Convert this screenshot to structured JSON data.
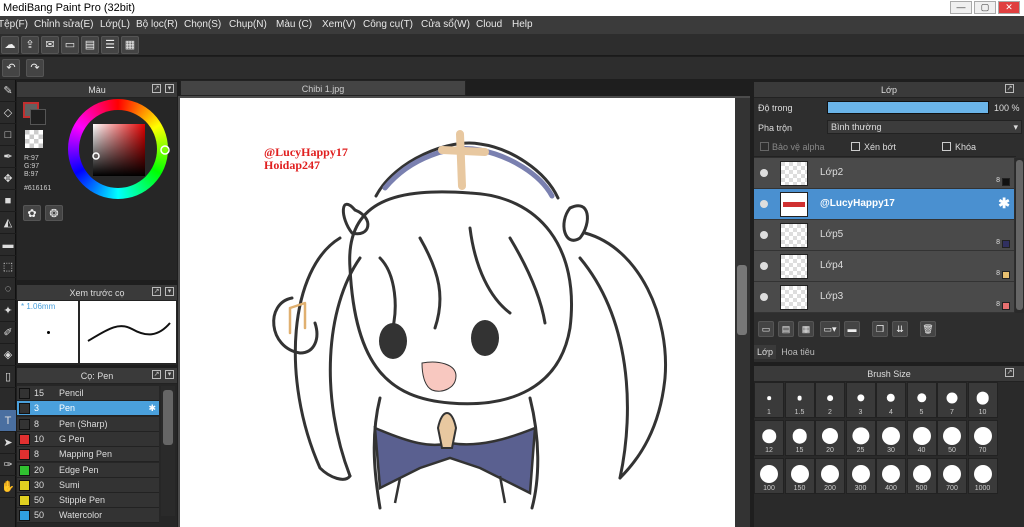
{
  "window": {
    "title": "MediBang Paint Pro (32bit)",
    "minimize": "—",
    "maximize": "▢",
    "close": "✕"
  },
  "menu": [
    "Tệp(F)",
    "Chỉnh sửa(E)",
    "Lớp(L)",
    "Bộ lọc(R)",
    "Chọn(S)",
    "Chụp(N)",
    "Màu (C)",
    "Xem(V)",
    "Công cụ(T)",
    "Cửa sổ(W)",
    "Cloud",
    "Help"
  ],
  "toolbar": {
    "cloud_icon": "cloud-icon",
    "share_icon": "share-icon",
    "comment_icon": "comment-icon",
    "undo_icon": "undo-icon",
    "redo_icon": "redo-icon"
  },
  "color_panel": {
    "title": "Màu",
    "rgb": "R:97\nG:97\nB:97",
    "hex": "#616161",
    "fg_color": "#616161"
  },
  "preview_panel": {
    "title": "Xem trước cọ",
    "size": "1.06mm"
  },
  "brush_panel": {
    "title": "Cọ: Pen",
    "items": [
      {
        "num": "15",
        "name": "Pencil",
        "color": "#333333"
      },
      {
        "num": "3",
        "name": "Pen",
        "color": "#333333",
        "selected": true
      },
      {
        "num": "8",
        "name": "Pen (Sharp)",
        "color": "#333333"
      },
      {
        "num": "10",
        "name": "G Pen",
        "color": "#e03030"
      },
      {
        "num": "8",
        "name": "Mapping Pen",
        "color": "#e03030"
      },
      {
        "num": "20",
        "name": "Edge Pen",
        "color": "#30c030"
      },
      {
        "num": "30",
        "name": "Sumi",
        "color": "#e0d020"
      },
      {
        "num": "50",
        "name": "Stipple Pen",
        "color": "#e0d020"
      },
      {
        "num": "50",
        "name": "Watercolor",
        "color": "#30a0e0"
      }
    ]
  },
  "document": {
    "tab": "Chibi 1.jpg",
    "watermark1": "@LucyHappy17",
    "watermark2": "Hoidap247"
  },
  "layer_panel": {
    "title": "Lớp",
    "opacity_label": "Độ trong",
    "opacity_value": "100 %",
    "opacity_fraction": 1.0,
    "blend_label": "Pha trộn",
    "blend_value": "Bình thường",
    "alpha_label": "Bảo vệ alpha",
    "clip_label": "Xén bớt",
    "lock_label": "Khóa",
    "layers": [
      {
        "name": "Lớp2",
        "n": "8",
        "color": "#111111"
      },
      {
        "name": "@LucyHappy17",
        "selected": true
      },
      {
        "name": "Lớp5",
        "n": "8",
        "color": "#303060"
      },
      {
        "name": "Lớp4",
        "n": "8",
        "color": "#e8c070"
      },
      {
        "name": "Lớp3",
        "n": "8",
        "color": "#e87070"
      }
    ],
    "tabs": [
      "Lớp",
      "Hoa tiêu"
    ]
  },
  "brush_size": {
    "title": "Brush Size",
    "sizes": [
      "1",
      "1.5",
      "2",
      "3",
      "4",
      "5",
      "7",
      "10",
      "12",
      "15",
      "20",
      "25",
      "30",
      "40",
      "50",
      "70",
      "100",
      "150",
      "200",
      "300",
      "400",
      "500",
      "700",
      "1000"
    ]
  }
}
